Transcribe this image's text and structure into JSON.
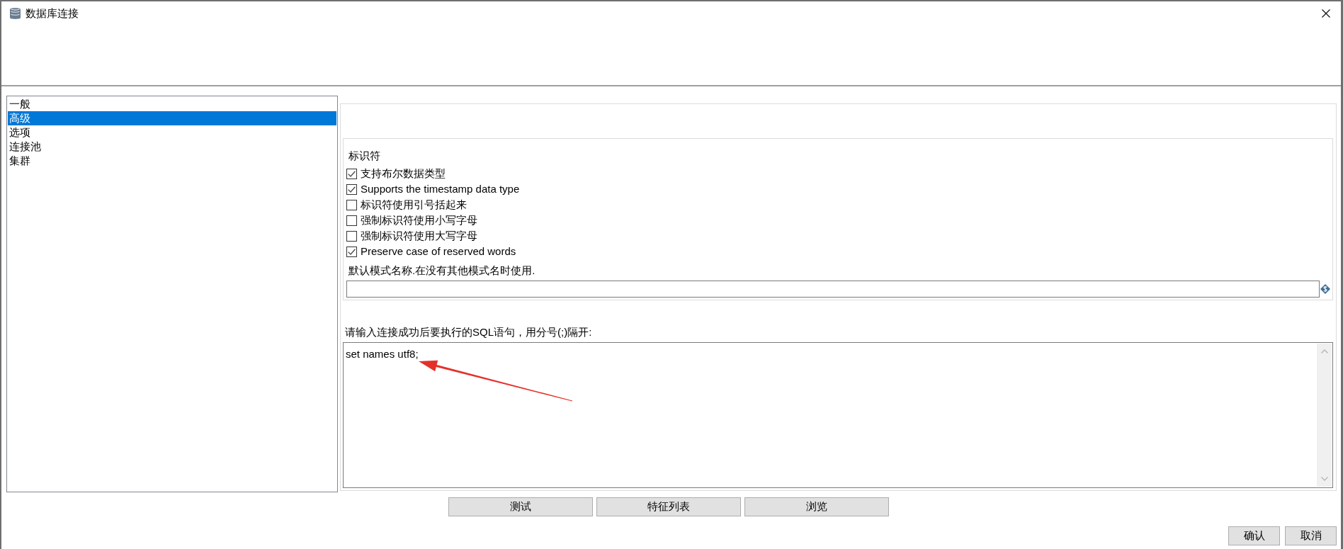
{
  "window": {
    "title": "数据库连接"
  },
  "sidebar": {
    "items": [
      {
        "label": "一般",
        "selected": false
      },
      {
        "label": "高级",
        "selected": true
      },
      {
        "label": "选项",
        "selected": false
      },
      {
        "label": "连接池",
        "selected": false
      },
      {
        "label": "集群",
        "selected": false
      }
    ]
  },
  "identifiers": {
    "title": "标识符",
    "options": [
      {
        "label": "支持布尔数据类型",
        "checked": true
      },
      {
        "label": "Supports the timestamp data type",
        "checked": true
      },
      {
        "label": "标识符使用引号括起来",
        "checked": false
      },
      {
        "label": "强制标识符使用小写字母",
        "checked": false
      },
      {
        "label": "强制标识符使用大写字母",
        "checked": false
      },
      {
        "label": "Preserve case of reserved words",
        "checked": true
      }
    ]
  },
  "default_schema": {
    "label": "默认模式名称.在没有其他模式名时使用."
  },
  "sql": {
    "label": "请输入连接成功后要执行的SQL语句，用分号(;)隔开:",
    "value": "set names utf8;"
  },
  "action_buttons": [
    {
      "label": "测试"
    },
    {
      "label": "特征列表"
    },
    {
      "label": "浏览"
    }
  ],
  "dialog_buttons": [
    {
      "label": "确认"
    },
    {
      "label": "取消"
    }
  ]
}
